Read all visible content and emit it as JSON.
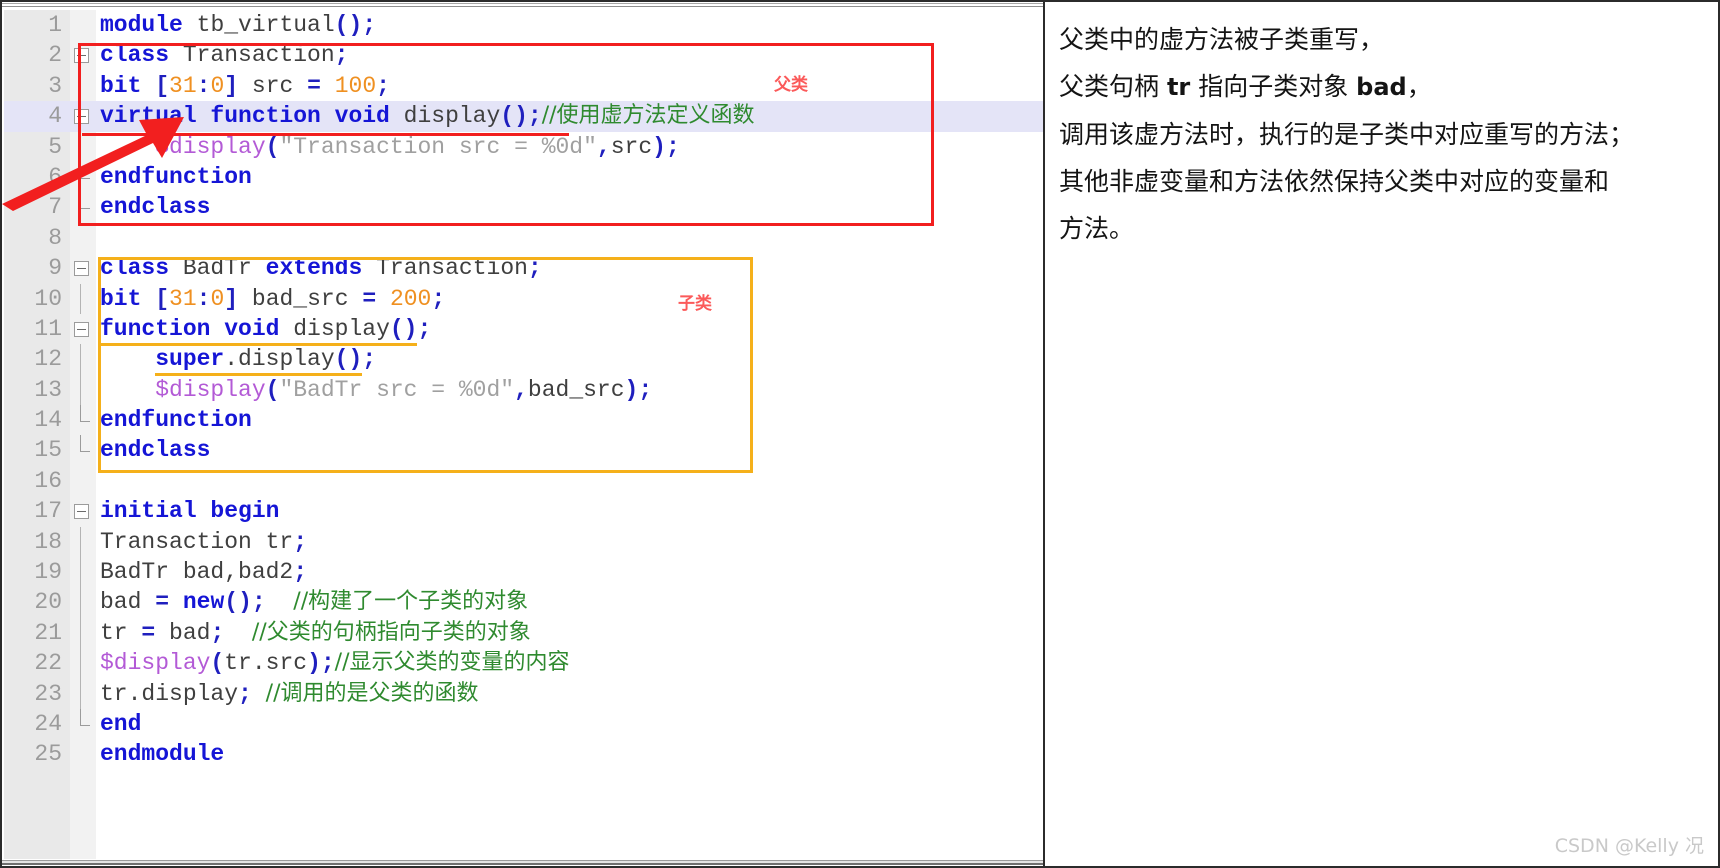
{
  "editor": {
    "language": "systemverilog",
    "highlighted_line": 4,
    "lines": [
      {
        "n": "1",
        "text": "module tb_virtual();"
      },
      {
        "n": "2",
        "text": "class Transaction;"
      },
      {
        "n": "3",
        "text": "bit [31:0] src = 100;"
      },
      {
        "n": "4",
        "text": "virtual function void display();//使用虚方法定义函数"
      },
      {
        "n": "5",
        "text": "    $display(\"Transaction src = %0d\",src);"
      },
      {
        "n": "6",
        "text": "endfunction"
      },
      {
        "n": "7",
        "text": "endclass"
      },
      {
        "n": "8",
        "text": ""
      },
      {
        "n": "9",
        "text": "class BadTr extends Transaction;"
      },
      {
        "n": "10",
        "text": "bit [31:0] bad_src = 200;"
      },
      {
        "n": "11",
        "text": "function void display();"
      },
      {
        "n": "12",
        "text": "    super.display();"
      },
      {
        "n": "13",
        "text": "    $display(\"BadTr src = %0d\",bad_src);"
      },
      {
        "n": "14",
        "text": "endfunction"
      },
      {
        "n": "15",
        "text": "endclass"
      },
      {
        "n": "16",
        "text": ""
      },
      {
        "n": "17",
        "text": "initial begin"
      },
      {
        "n": "18",
        "text": "Transaction tr;"
      },
      {
        "n": "19",
        "text": "BadTr bad,bad2;"
      },
      {
        "n": "20",
        "text": "bad = new();  //构建了一个子类的对象"
      },
      {
        "n": "21",
        "text": "tr = bad;  //父类的句柄指向子类的对象"
      },
      {
        "n": "22",
        "text": "$display(tr.src);//显示父类的变量的内容"
      },
      {
        "n": "23",
        "text": "tr.display; //调用的是父类的函数"
      },
      {
        "n": "24",
        "text": "end"
      },
      {
        "n": "25",
        "text": "endmodule"
      }
    ],
    "tokens": {
      "l1": [
        {
          "t": "module",
          "c": "kw"
        },
        {
          "t": " ",
          "c": "plain"
        },
        {
          "t": "tb_virtual",
          "c": "ident"
        },
        {
          "t": "()",
          "c": "punct"
        },
        {
          "t": ";",
          "c": "punct"
        }
      ],
      "l2": [
        {
          "t": "class",
          "c": "kw"
        },
        {
          "t": " ",
          "c": "plain"
        },
        {
          "t": "Transaction",
          "c": "ident"
        },
        {
          "t": ";",
          "c": "punct"
        }
      ],
      "l3": [
        {
          "t": "bit",
          "c": "kw"
        },
        {
          "t": " ",
          "c": "plain"
        },
        {
          "t": "[",
          "c": "punct"
        },
        {
          "t": "31",
          "c": "numlit"
        },
        {
          "t": ":",
          "c": "punct"
        },
        {
          "t": "0",
          "c": "numlit"
        },
        {
          "t": "]",
          "c": "punct"
        },
        {
          "t": " src ",
          "c": "ident"
        },
        {
          "t": "=",
          "c": "punct"
        },
        {
          "t": " ",
          "c": "plain"
        },
        {
          "t": "100",
          "c": "numlit"
        },
        {
          "t": ";",
          "c": "punct"
        }
      ],
      "l4": [
        {
          "t": "virtual function void",
          "c": "kw"
        },
        {
          "t": " ",
          "c": "plain"
        },
        {
          "t": "display",
          "c": "ident"
        },
        {
          "t": "()",
          "c": "punct"
        },
        {
          "t": ";",
          "c": "punct"
        },
        {
          "t": "//使用虚方法定义函数",
          "c": "cmt"
        }
      ],
      "l5": [
        {
          "t": "    ",
          "c": "plain"
        },
        {
          "t": "$display",
          "c": "sys"
        },
        {
          "t": "(",
          "c": "punct"
        },
        {
          "t": "\"Transaction src = %0d\"",
          "c": "str"
        },
        {
          "t": ",",
          "c": "punct"
        },
        {
          "t": "src",
          "c": "ident"
        },
        {
          "t": ")",
          "c": "punct"
        },
        {
          "t": ";",
          "c": "punct"
        }
      ],
      "l6": [
        {
          "t": "endfunction",
          "c": "kw"
        }
      ],
      "l7": [
        {
          "t": "endclass",
          "c": "kw"
        }
      ],
      "l9": [
        {
          "t": "class",
          "c": "kw"
        },
        {
          "t": " ",
          "c": "plain"
        },
        {
          "t": "BadTr",
          "c": "ident"
        },
        {
          "t": " ",
          "c": "plain"
        },
        {
          "t": "extends",
          "c": "kw"
        },
        {
          "t": " ",
          "c": "plain"
        },
        {
          "t": "Transaction",
          "c": "ident"
        },
        {
          "t": ";",
          "c": "punct"
        }
      ],
      "l10": [
        {
          "t": "bit",
          "c": "kw"
        },
        {
          "t": " ",
          "c": "plain"
        },
        {
          "t": "[",
          "c": "punct"
        },
        {
          "t": "31",
          "c": "numlit"
        },
        {
          "t": ":",
          "c": "punct"
        },
        {
          "t": "0",
          "c": "numlit"
        },
        {
          "t": "]",
          "c": "punct"
        },
        {
          "t": " bad_src ",
          "c": "ident"
        },
        {
          "t": "=",
          "c": "punct"
        },
        {
          "t": " ",
          "c": "plain"
        },
        {
          "t": "200",
          "c": "numlit"
        },
        {
          "t": ";",
          "c": "punct"
        }
      ],
      "l11": [
        {
          "t": "function void",
          "c": "kw"
        },
        {
          "t": " ",
          "c": "plain"
        },
        {
          "t": "display",
          "c": "ident"
        },
        {
          "t": "()",
          "c": "punct"
        },
        {
          "t": ";",
          "c": "punct"
        }
      ],
      "l12": [
        {
          "t": "    ",
          "c": "plain"
        },
        {
          "t": "super",
          "c": "kw"
        },
        {
          "t": ".",
          "c": "plain"
        },
        {
          "t": "display",
          "c": "ident"
        },
        {
          "t": "()",
          "c": "punct"
        },
        {
          "t": ";",
          "c": "punct"
        }
      ],
      "l13": [
        {
          "t": "    ",
          "c": "plain"
        },
        {
          "t": "$display",
          "c": "sys"
        },
        {
          "t": "(",
          "c": "punct"
        },
        {
          "t": "\"BadTr src = %0d\"",
          "c": "str"
        },
        {
          "t": ",",
          "c": "punct"
        },
        {
          "t": "bad_src",
          "c": "ident"
        },
        {
          "t": ")",
          "c": "punct"
        },
        {
          "t": ";",
          "c": "punct"
        }
      ],
      "l14": [
        {
          "t": "endfunction",
          "c": "kw"
        }
      ],
      "l15": [
        {
          "t": "endclass",
          "c": "kw"
        }
      ],
      "l17": [
        {
          "t": "initial begin",
          "c": "kw"
        }
      ],
      "l18": [
        {
          "t": "Transaction tr",
          "c": "ident"
        },
        {
          "t": ";",
          "c": "punct"
        }
      ],
      "l19": [
        {
          "t": "BadTr bad,bad2",
          "c": "ident"
        },
        {
          "t": ";",
          "c": "punct"
        }
      ],
      "l20": [
        {
          "t": "bad ",
          "c": "ident"
        },
        {
          "t": "=",
          "c": "punct"
        },
        {
          "t": " ",
          "c": "plain"
        },
        {
          "t": "new",
          "c": "kw"
        },
        {
          "t": "()",
          "c": "punct"
        },
        {
          "t": ";",
          "c": "punct"
        },
        {
          "t": "  ",
          "c": "plain"
        },
        {
          "t": "//构建了一个子类的对象",
          "c": "cmt"
        }
      ],
      "l21": [
        {
          "t": "tr ",
          "c": "ident"
        },
        {
          "t": "=",
          "c": "punct"
        },
        {
          "t": " bad",
          "c": "ident"
        },
        {
          "t": ";",
          "c": "punct"
        },
        {
          "t": "  ",
          "c": "plain"
        },
        {
          "t": "//父类的句柄指向子类的对象",
          "c": "cmt"
        }
      ],
      "l22": [
        {
          "t": "$display",
          "c": "sys"
        },
        {
          "t": "(",
          "c": "punct"
        },
        {
          "t": "tr.src",
          "c": "ident"
        },
        {
          "t": ")",
          "c": "punct"
        },
        {
          "t": ";",
          "c": "punct"
        },
        {
          "t": "//显示父类的变量的内容",
          "c": "cmt"
        }
      ],
      "l23": [
        {
          "t": "tr.display",
          "c": "ident"
        },
        {
          "t": ";",
          "c": "punct"
        },
        {
          "t": " ",
          "c": "plain"
        },
        {
          "t": "//调用的是父类的函数",
          "c": "cmt"
        }
      ],
      "l24": [
        {
          "t": "end",
          "c": "kw"
        }
      ],
      "l25": [
        {
          "t": "endmodule",
          "c": "kw"
        }
      ]
    }
  },
  "annotations": {
    "parent_label": "父类",
    "child_label": "子类",
    "parent_box_color": "#f21f1f",
    "child_box_color": "#f5b01a",
    "arrow_color": "#f21f1f"
  },
  "notes": {
    "lines": [
      "父类中的虚方法被子类重写，",
      "父类句柄 tr 指向子类对象 bad，",
      "调用该虚方法时，执行的是子类中对应重写的方法；",
      "其他非虚变量和方法依然保持父类中对应的变量和",
      "方法。"
    ]
  },
  "watermark": {
    "text": "CSDN @Kelly 况"
  }
}
